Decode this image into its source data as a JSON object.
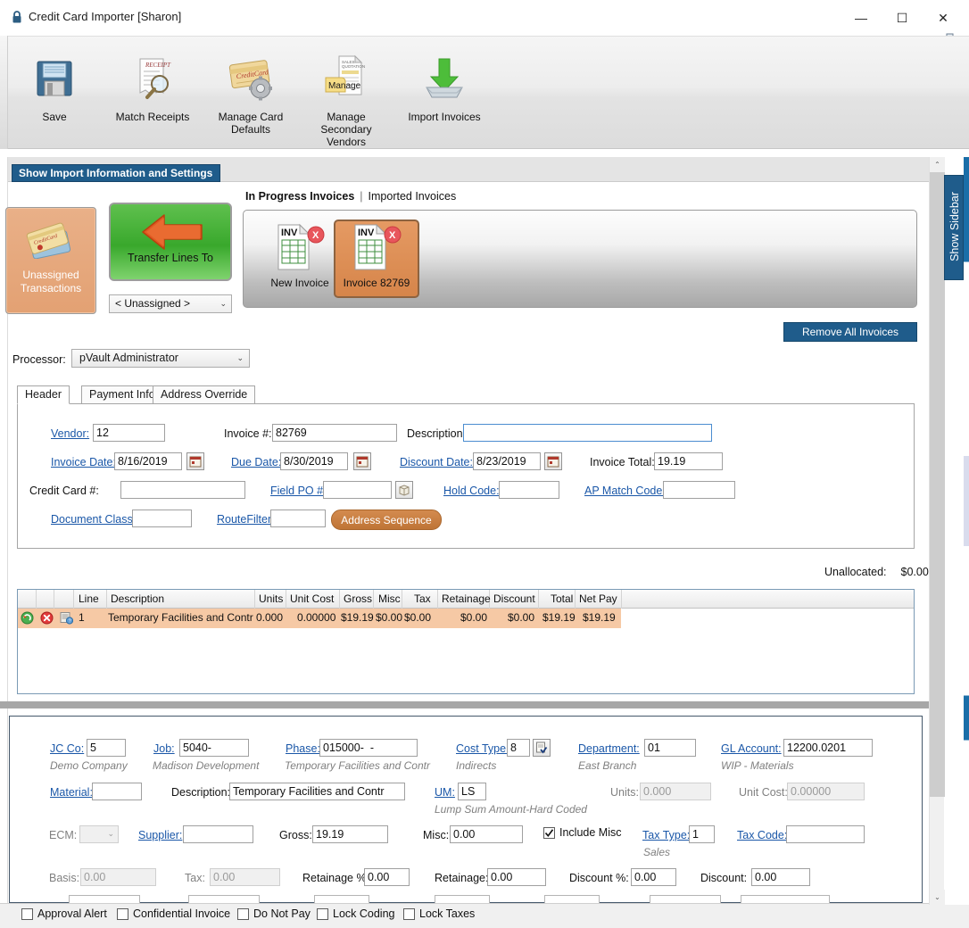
{
  "window": {
    "title": "Credit Card Importer [Sharon]",
    "lock_icon": "lock-icon",
    "minimize": "—",
    "maximize": "☐",
    "close": "✕"
  },
  "toolbar": {
    "items": [
      {
        "id": "save",
        "label": "Save",
        "icon": "floppy-disk-icon"
      },
      {
        "id": "match-receipts",
        "label": "Match Receipts",
        "icon": "receipt-magnifier-icon"
      },
      {
        "id": "manage-card-defaults",
        "label": "Manage Card\nDefaults",
        "line1": "Manage Card",
        "line2": "Defaults",
        "icon": "credit-card-gear-icon"
      },
      {
        "id": "secondary-vendors",
        "label": "Manage\nSecondary\nVendors",
        "line1": "Manage",
        "line2": "Secondary",
        "line3": "Vendors",
        "icon": "document-folder-icon"
      },
      {
        "id": "import-invoices",
        "label": "Import Invoices",
        "icon": "green-down-arrow-tray-icon"
      }
    ]
  },
  "ribbon": {
    "show_import_button": "Show Import Information and Settings"
  },
  "left_panel": {
    "unassigned_button": {
      "line1": "Unassigned",
      "line2": "Transactions",
      "icon": "credit-cards-icon"
    },
    "transfer_button": {
      "label": "Transfer Lines To",
      "icon": "orange-left-arrow-icon"
    },
    "unassigned_select": {
      "value": "< Unassigned >",
      "chevron": "⌄"
    }
  },
  "invoices": {
    "tab_in_progress": "In Progress Invoices",
    "tab_separator": "|",
    "tab_imported": "Imported Invoices",
    "cards": [
      {
        "id": "new-invoice",
        "label": "New Invoice",
        "selected": false
      },
      {
        "id": "invoice-82769",
        "label": "Invoice 82769",
        "selected": true
      }
    ],
    "remove_all_label": "Remove All Invoices"
  },
  "processor": {
    "label": "Processor:",
    "value": "pVault Administrator",
    "chevron": "⌄"
  },
  "tabs": [
    {
      "id": "header",
      "label": "Header",
      "active": true
    },
    {
      "id": "payment-info",
      "label": "Payment Info",
      "active": false
    },
    {
      "id": "address-override",
      "label": "Address Override",
      "active": false
    }
  ],
  "header_form": {
    "vendor_label": "Vendor:",
    "vendor_value": "12",
    "invoice_num_label": "Invoice #:",
    "invoice_num_value": "82769",
    "description_label": "Description:",
    "description_value": "",
    "invoice_date_label": "Invoice Date:",
    "invoice_date_value": "8/16/2019",
    "due_date_label": "Due Date:",
    "due_date_value": "8/30/2019",
    "discount_date_label": "Discount Date:",
    "discount_date_value": "8/23/2019",
    "invoice_total_label": "Invoice Total:",
    "invoice_total_value": "19.19",
    "credit_card_label": "Credit Card #:",
    "credit_card_value": "",
    "field_po_label": "Field PO #:",
    "field_po_value": "",
    "hold_code_label": "Hold Code:",
    "hold_code_value": "",
    "ap_match_label": "AP Match Code:",
    "ap_match_value": "",
    "document_class_label": "Document Class:",
    "document_class_value": "",
    "route_filter_label": "RouteFilter:",
    "route_filter_value": "",
    "address_sequence_label": "Address Sequence"
  },
  "unallocated": {
    "label": "Unallocated:",
    "value": "$0.00"
  },
  "grid": {
    "columns": [
      "Line",
      "Description",
      "Units",
      "Unit Cost",
      "Gross",
      "Misc",
      "Tax",
      "Retainage",
      "Discount",
      "Total",
      "Net Pay"
    ],
    "rows": [
      {
        "icons": [
          "refresh-icon",
          "delete-icon",
          "info-icon"
        ],
        "line": "1",
        "description": "Temporary Facilities and Contr",
        "units": "0.000",
        "unit_cost": "0.00000",
        "gross": "$19.19",
        "misc": "$0.00",
        "tax": "$0.00",
        "retainage": "$0.00",
        "discount": "$0.00",
        "total": "$19.19",
        "net_pay": "$19.19"
      }
    ]
  },
  "detail_form": {
    "jc_co_label": "JC Co:",
    "jc_co_value": "5",
    "jc_co_sub": "Demo Company",
    "job_label": "Job:",
    "job_value": "5040-",
    "job_sub": "Madison Development",
    "phase_label": "Phase:",
    "phase_value": "015000-  -",
    "phase_sub": "Temporary Facilities and Contr",
    "cost_type_label": "Cost Type:",
    "cost_type_value": "8",
    "cost_type_sub": "Indirects",
    "department_label": "Department:",
    "department_value": "01",
    "department_sub": "East Branch",
    "gl_account_label": "GL Account:",
    "gl_account_value": "12200.0201",
    "gl_account_sub": "WIP - Materials",
    "material_label": "Material:",
    "material_value": "",
    "description_label": "Description:",
    "description_value": "Temporary Facilities and Contr",
    "um_label": "UM:",
    "um_value": "LS",
    "um_sub": "Lump Sum Amount-Hard Coded",
    "units_label": "Units:",
    "units_value": "0.000",
    "unit_cost_label": "Unit Cost:",
    "unit_cost_value": "0.00000",
    "ecm_label": "ECM:",
    "ecm_value": "",
    "supplier_label": "Supplier:",
    "supplier_value": "",
    "gross_label": "Gross:",
    "gross_value": "19.19",
    "misc_label": "Misc:",
    "misc_value": "0.00",
    "include_misc_label": "Include Misc",
    "include_misc_checked": true,
    "tax_type_label": "Tax Type:",
    "tax_type_value": "1",
    "tax_type_sub": "Sales",
    "tax_code_label": "Tax Code:",
    "tax_code_value": "",
    "basis_label": "Basis:",
    "basis_value": "0.00",
    "tax_label": "Tax:",
    "tax_value": "0.00",
    "retainage_pct_label": "Retainage %:",
    "retainage_pct_value": "0.00",
    "retainage_label": "Retainage:",
    "retainage_value": "0.00",
    "discount_pct_label": "Discount %:",
    "discount_pct_value": "0.00",
    "discount_label": "Discount:",
    "discount_value": "0.00"
  },
  "footer": {
    "checkboxes": [
      {
        "id": "approval-alert",
        "label": "Approval Alert",
        "checked": false
      },
      {
        "id": "confidential-invoice",
        "label": "Confidential Invoice",
        "checked": false
      },
      {
        "id": "do-not-pay",
        "label": "Do Not Pay",
        "checked": false
      },
      {
        "id": "lock-coding",
        "label": "Lock Coding",
        "checked": false
      },
      {
        "id": "lock-taxes",
        "label": "Lock Taxes",
        "checked": false
      }
    ]
  },
  "sidebar": {
    "show_sidebar_label": "Show Sidebar"
  },
  "scrollbar": {
    "up": "⌃",
    "down": "⌄"
  },
  "colors": {
    "accent_blue": "#1f5c8b",
    "orange_selected": "#d6854a",
    "row_highlight": "#f6c9a5",
    "link_blue": "#1a57a8"
  }
}
